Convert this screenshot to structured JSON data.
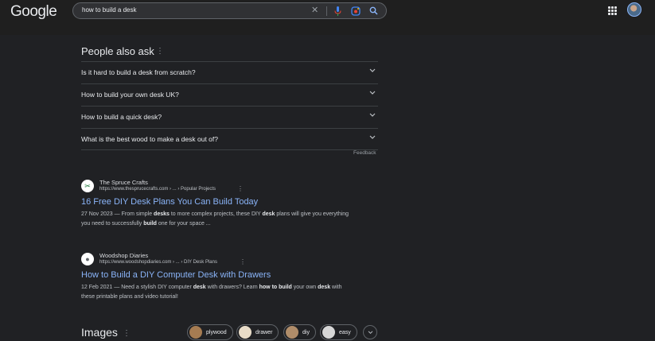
{
  "header": {
    "logo": "Google",
    "search_query": "how to build a desk"
  },
  "people_also_ask": {
    "title": "People also ask",
    "questions": [
      "Is it hard to build a desk from scratch?",
      "How to build your own desk UK?",
      "How to build a quick desk?",
      "What is the best wood to make a desk out of?"
    ],
    "feedback": "Feedback"
  },
  "results": [
    {
      "site_name": "The Spruce Crafts",
      "url": "https://www.thesprucecrafts.com › ... › Popular Projects",
      "title": "16 Free DIY Desk Plans You Can Build Today",
      "snippet_html": "27 Nov 2023 — From simple <b>desks</b> to more complex projects, these DIY <b>desk</b> plans will give you everything you need to successfully <b>build</b> one for your space ..."
    },
    {
      "site_name": "Woodshop Diaries",
      "url": "https://www.woodshopdiaries.com › ... › DIY Desk Plans",
      "title": "How to Build a DIY Computer Desk with Drawers",
      "snippet_html": "12 Feb 2021 — Need a stylish DIY computer <b>desk</b> with drawers? Learn <b>how to build</b> your own <b>desk</b> with these printable plans and video tutorial!"
    }
  ],
  "images": {
    "title": "Images",
    "chips": [
      "plywood",
      "drawer",
      "diy",
      "easy"
    ]
  },
  "colors": {
    "background": "#202124",
    "link": "#8ab4f8",
    "text": "#e8eaed"
  }
}
